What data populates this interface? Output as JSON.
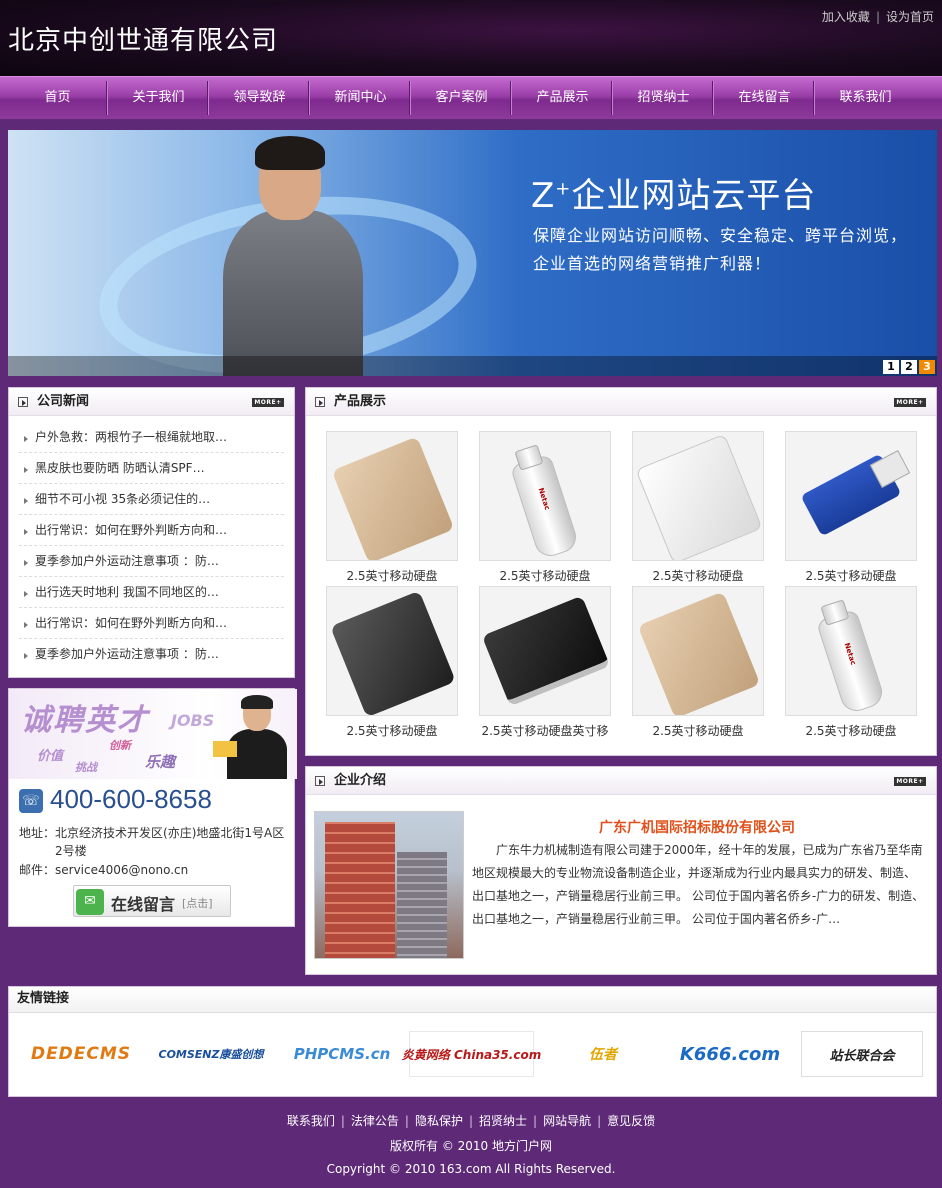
{
  "header": {
    "site_title": "北京中创世通有限公司",
    "add_favorite": "加入收藏",
    "set_homepage": "设为首页"
  },
  "nav": {
    "items": [
      "首页",
      "关于我们",
      "领导致辞",
      "新闻中心",
      "客户案例",
      "产品展示",
      "招贤纳士",
      "在线留言",
      "联系我们"
    ]
  },
  "banner": {
    "title_main": "Z",
    "title_sup": "+",
    "title_rest": "企业网站云平台",
    "subtitle_line1": "保障企业网站访问顺畅、安全稳定、跨平台浏览，",
    "subtitle_line2": "企业首选的网络营销推广利器！",
    "pager": [
      "1",
      "2",
      "3"
    ],
    "active_page": "3"
  },
  "company_news": {
    "title": "公司新闻",
    "more": "MORE+",
    "items": [
      "户外急救：两根竹子一根绳就地取…",
      "黑皮肤也要防晒 防晒认清SPF…",
      "细节不可小视 35条必须记住的…",
      "出行常识：如何在野外判断方向和…",
      "夏季参加户外运动注意事项 ：防…",
      "出行选天时地利 我国不同地区的…",
      "出行常识：如何在野外判断方向和…",
      "夏季参加户外运动注意事项 ：防…"
    ]
  },
  "contact": {
    "jobs_title": "诚聘英才",
    "jobs_en": "JOBS",
    "jobs_words": [
      "创新",
      "价值",
      "挑战",
      "乐趣"
    ],
    "phone": "400-600-8658",
    "address_label": "地址：",
    "address": "北京经济技术开发区(亦庄)地盛北街1号A区2号楼",
    "email_label": "邮件：",
    "email": "service4006@nono.cn",
    "message_button": "在线留言",
    "message_click": "[点击]"
  },
  "products": {
    "title": "产品展示",
    "more": "MORE+",
    "items": [
      {
        "caption": "2.5英寸移动硬盘",
        "kind": "gold-disk"
      },
      {
        "caption": "2.5英寸移动硬盘",
        "kind": "white-usb"
      },
      {
        "caption": "2.5英寸移动硬盘",
        "kind": "white-disk"
      },
      {
        "caption": "2.5英寸移动硬盘",
        "kind": "blue-usb"
      },
      {
        "caption": "2.5英寸移动硬盘",
        "kind": "black-disk"
      },
      {
        "caption": "2.5英寸移动硬盘英寸移",
        "kind": "black-silver-disk"
      },
      {
        "caption": "2.5英寸移动硬盘",
        "kind": "gold-disk"
      },
      {
        "caption": "2.5英寸移动硬盘",
        "kind": "white-usb"
      }
    ]
  },
  "company_intro": {
    "title": "企业介绍",
    "more": "MORE+",
    "company_name": "广东广机国际招标股份有限公司",
    "description": "广东牛力机械制造有限公司建于2000年，经十年的发展，已成为广东省乃至华南地区规模最大的专业物流设备制造企业，并逐渐成为行业内最具实力的研发、制造、出口基地之一，产销量稳居行业前三甲。 公司位于国内著名侨乡-广力的研发、制造、出口基地之一，产销量稳居行业前三甲。 公司位于国内著名侨乡-广…"
  },
  "friend_links": {
    "title": "友情链接",
    "logos": [
      "DEDECMS",
      "COMSENZ康盛创想",
      "PHPCMS.cn",
      "炎黄网络 China35.com",
      "伍者",
      "K666.com",
      "站长联合会"
    ]
  },
  "footer": {
    "links": [
      "联系我们",
      "法律公告",
      "隐私保护",
      "招贤纳士",
      "网站导航",
      "意见反馈"
    ],
    "copyright": "版权所有 © 2010 地方门户网",
    "rights": "Copyright © 2010 163.com All Rights Reserved."
  }
}
